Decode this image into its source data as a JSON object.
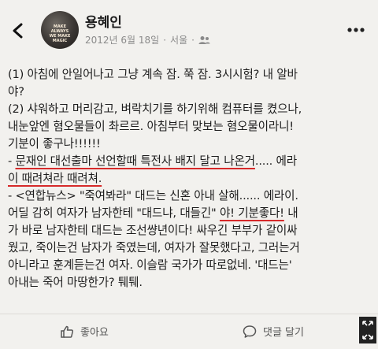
{
  "header": {
    "author_name": "용혜인",
    "date": "2012년 6월 18일",
    "separator": "·",
    "location": "서울",
    "avatar_text": [
      "MAKE",
      "ALWAYS",
      "WE MAKE",
      "MAGIC"
    ],
    "privacy_icon": "friends-icon",
    "back_icon": "chevron-left-icon",
    "more_icon": "more-horizontal-icon"
  },
  "post": {
    "lines": [
      "(1) 아침에 안일어나고 그냥 계속 잠. 쭉 잠. 3시시험? 내 알바",
      "야?",
      "(2) 샤워하고 머리감고, 벼락치기를 하기위해 컴퓨터를 켰으나,",
      "내눈앞엔 혐오물들이 촤르르. 아침부터 맞보는 혐오물이라니!",
      "기분이 좋구나!!!!!!"
    ],
    "line6_prefix": "- ",
    "line6_underlined": "문재인 대선출마 선언할때 특전사 배지 달고 나온거",
    "line6_suffix": "..... 에라",
    "line7_underlined": "이 때려쳐라 때려쳐.",
    "line8": "- <연합뉴스> \"죽여봐라\" 대드는 신혼 아내 살해...... 에라이.",
    "line9_prefix": "어딜 감히 여자가 남자한테 \"대드냐, 대들긴\" ",
    "line9_underlined": "야! 기분좋다!",
    "line9_suffix": " 내",
    "lines_rest": [
      "가 바로 남자한테 대드는 조선썅년이다! 싸우긴 부부가 같이싸",
      "웠고, 죽이는건 남자가 죽였는데, 여자가 잘못했다고, 그러는거",
      "아니라고 훈계듣는건 여자. 이슬람 국가가 따로없네. '대드는'",
      "아내는 죽어 마땅한가? 퉤퉤."
    ]
  },
  "actions": {
    "like_label": "좋아요",
    "comment_label": "댓글 달기",
    "like_icon": "thumbs-up-icon",
    "comment_icon": "comment-icon",
    "expand_icon": "expand-icon"
  },
  "colors": {
    "underline": "#d62a2a",
    "background": "#f2f1ee"
  }
}
